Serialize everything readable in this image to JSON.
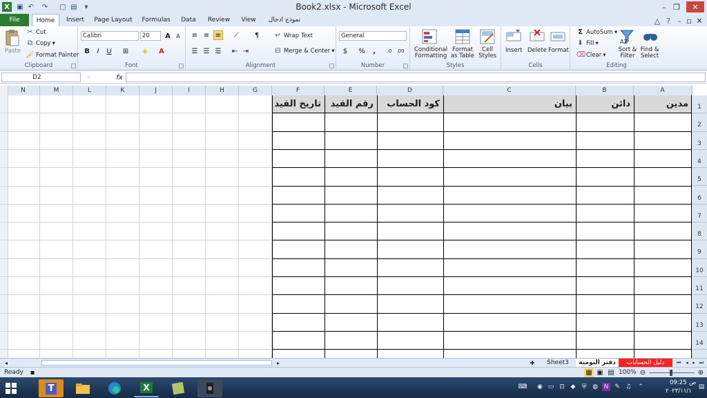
{
  "window": {
    "title": "Book2.xlsx  -  Microsoft Excel"
  },
  "tabs": [
    "File",
    "Home",
    "Insert",
    "Page Layout",
    "Formulas",
    "Data",
    "Review",
    "View",
    "نموذج ادخال"
  ],
  "ribbon": {
    "clipboard": {
      "label": "Clipboard",
      "paste": "Paste",
      "cut": "Cut",
      "copy": "Copy",
      "format_painter": "Format Painter"
    },
    "font": {
      "label": "Font",
      "name": "Calibri",
      "size": "20",
      "bold": "B",
      "italic": "I",
      "underline": "U"
    },
    "alignment": {
      "label": "Alignment",
      "wrap": "Wrap Text",
      "merge": "Merge & Center"
    },
    "number": {
      "label": "Number",
      "format": "General",
      "percent": "%",
      "comma": ","
    },
    "styles": {
      "label": "Styles",
      "conditional": "Conditional",
      "conditional2": "Formatting",
      "format_table": "Format",
      "format_table2": "as Table",
      "cell_styles": "Cell",
      "cell_styles2": "Styles"
    },
    "cells": {
      "label": "Cells",
      "insert": "Insert",
      "delete": "Delete",
      "format": "Format"
    },
    "editing": {
      "label": "Editing",
      "autosum": "AutoSum",
      "fill": "Fill",
      "clear": "Clear",
      "sort": "Sort &",
      "sort2": "Filter",
      "find": "Find &",
      "find2": "Select"
    }
  },
  "formula_bar": {
    "name_box": "D2",
    "fx": "fx",
    "value": ""
  },
  "columns": [
    {
      "letter": "N",
      "w": 48
    },
    {
      "letter": "M",
      "w": 48
    },
    {
      "letter": "L",
      "w": 48
    },
    {
      "letter": "K",
      "w": 48
    },
    {
      "letter": "J",
      "w": 48
    },
    {
      "letter": "I",
      "w": 48
    },
    {
      "letter": "H",
      "w": 48
    },
    {
      "letter": "G",
      "w": 48
    },
    {
      "letter": "F",
      "w": 76
    },
    {
      "letter": "E",
      "w": 76
    },
    {
      "letter": "D",
      "w": 96
    },
    {
      "letter": "C",
      "w": 192
    },
    {
      "letter": "B",
      "w": 84
    },
    {
      "letter": "A",
      "w": 84
    }
  ],
  "rows": [
    "1",
    "2",
    "3",
    "4",
    "5",
    "6",
    "7",
    "8",
    "9",
    "10",
    "11",
    "12",
    "13",
    "14"
  ],
  "headers": {
    "F": "تاريخ القيد",
    "E": "رقم القيد",
    "D": "كود الحساب",
    "C": "بيان",
    "B": "دائن",
    "A": "مدين"
  },
  "sheets": [
    "Sheet3",
    "دفتر اليومية",
    "دليل الحسابات"
  ],
  "status": {
    "ready": "Ready",
    "zoom": "100%"
  },
  "clock": {
    "time": "09:25",
    "period": "ص",
    "date": "٢٠٢٣/١١/١"
  },
  "colors": {
    "accent": "#2a7d31",
    "sheet_tab_red": "#ff2020",
    "header_fill": "#d9d9d9"
  }
}
